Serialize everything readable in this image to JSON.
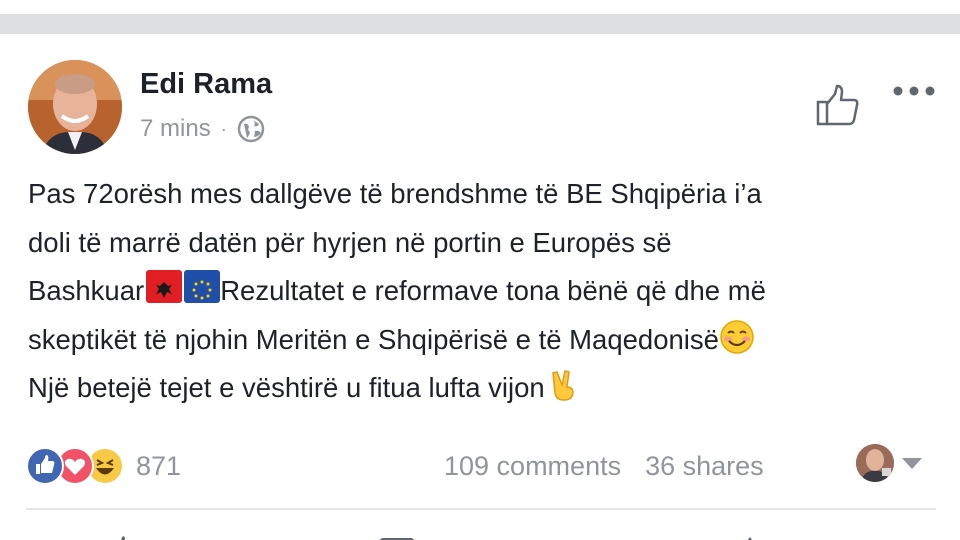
{
  "post": {
    "author": "Edi Rama",
    "time": "7 mins",
    "separator": "·",
    "privacy_icon": "globe-icon",
    "header_actions": [
      "like-icon",
      "more-icon"
    ],
    "text_lines": {
      "l1": "Pas 72orësh mes dallgëve të brendshme të BE Shqipëria i’a",
      "l2": "doli të marrë datën për hyrjen në portin e Europës së",
      "l3a": "Bashkuar",
      "l3b": "Rezultatet e reformave tona bënë që dhe më",
      "l4": "skeptikët të njohin Meritën e Shqipërisë e të Maqedonisë",
      "l5": "Një betejë tejet e vështirë u fitua lufta vijon"
    },
    "inline_emojis": [
      "albania-flag",
      "eu-flag",
      "smiling-face",
      "victory-hand"
    ]
  },
  "footer": {
    "reaction_icons": [
      "like-reaction-icon",
      "love-reaction-icon",
      "haha-reaction-icon"
    ],
    "reaction_count": "871",
    "comments": "109 comments",
    "shares": "36 shares"
  },
  "colors": {
    "primary_text": "#1d2129",
    "secondary_text": "#90949c",
    "like_blue": "#4267b2",
    "love_red": "#f25268",
    "haha_yellow": "#f7c945"
  }
}
